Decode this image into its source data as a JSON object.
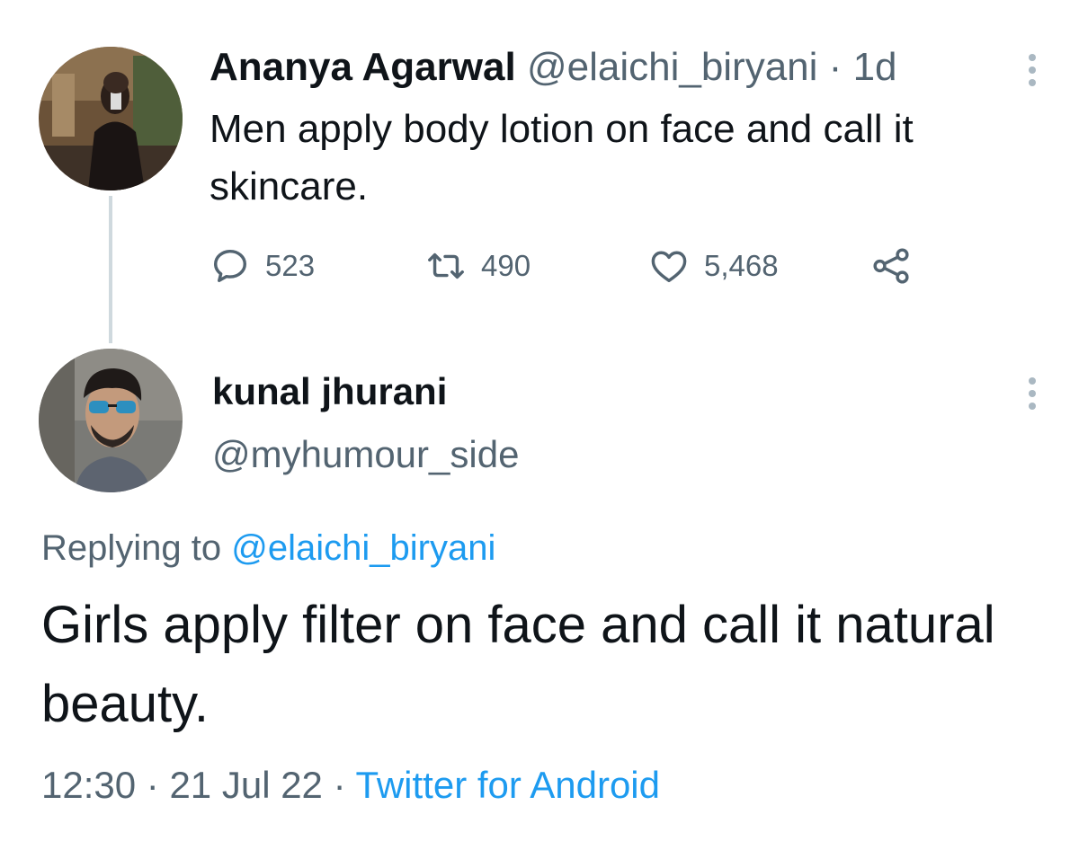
{
  "original_tweet": {
    "author_name": "Ananya Agarwal",
    "handle": "@elaichi_biryani",
    "separator": "·",
    "time_ago": "1d",
    "text": "Men apply body lotion on face and call it skincare.",
    "actions": {
      "reply_count": "523",
      "retweet_count": "490",
      "like_count": "5,468"
    }
  },
  "reply_tweet": {
    "author_name": "kunal jhurani",
    "handle": "@myhumour_side",
    "replying_prefix": "Replying to",
    "replying_handle": "@elaichi_biryani",
    "text": "Girls apply filter on face and call it natural beauty.",
    "time": "12:30",
    "date": "21 Jul 22",
    "separator": "·",
    "source": "Twitter for Android"
  },
  "icons": {
    "reply": "speech-bubble-icon",
    "retweet": "retweet-icon",
    "like": "heart-icon",
    "share": "share-icon",
    "more": "more-vertical-icon"
  },
  "colors": {
    "text": "#0f1419",
    "muted": "#536471",
    "link": "#1d9bf0",
    "thread_line": "#cfd9de",
    "more_dots": "#aab8c2"
  }
}
